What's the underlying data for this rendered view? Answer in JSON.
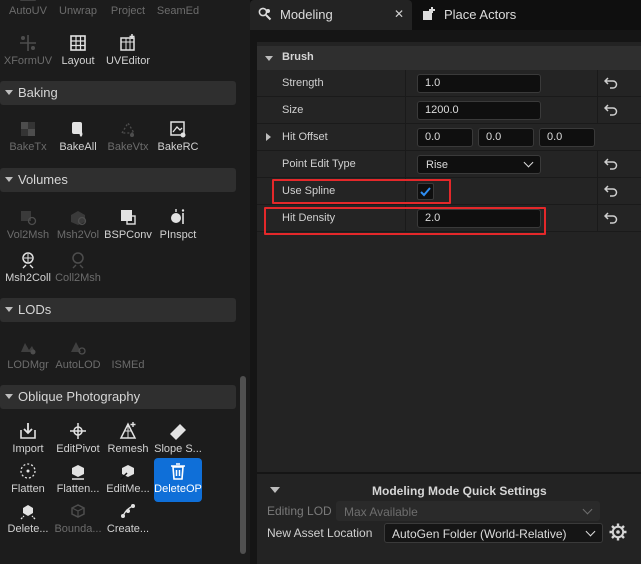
{
  "tool_panel": {
    "top_row": [
      {
        "label": "AutoUV",
        "icon": "auto-uv-icon",
        "enabled": false
      },
      {
        "label": "Unwrap",
        "icon": "unwrap-icon",
        "enabled": false
      },
      {
        "label": "Project",
        "icon": "project-icon",
        "enabled": false
      },
      {
        "label": "SeamEd",
        "icon": "seam-edit-icon",
        "enabled": false
      }
    ],
    "uv_row": [
      {
        "label": "XFormUV",
        "icon": "xform-uv-icon",
        "enabled": false
      },
      {
        "label": "Layout",
        "icon": "layout-icon",
        "enabled": true
      },
      {
        "label": "UVEditor",
        "icon": "uv-editor-icon",
        "enabled": true
      }
    ],
    "categories": {
      "baking": "Baking",
      "volumes": "Volumes",
      "lods": "LODs",
      "oblique": "Oblique Photography"
    },
    "baking": [
      {
        "label": "BakeTx",
        "icon": "bake-texture-icon",
        "enabled": false
      },
      {
        "label": "BakeAll",
        "icon": "bake-all-icon",
        "enabled": true
      },
      {
        "label": "BakeVtx",
        "icon": "bake-vertex-icon",
        "enabled": false
      },
      {
        "label": "BakeRC",
        "icon": "bake-rc-icon",
        "enabled": true
      }
    ],
    "volumes": [
      {
        "label": "Vol2Msh",
        "icon": "volume-to-mesh-icon",
        "enabled": false
      },
      {
        "label": "Msh2Vol",
        "icon": "mesh-to-volume-icon",
        "enabled": false
      },
      {
        "label": "BSPConv",
        "icon": "bsp-convert-icon",
        "enabled": true
      },
      {
        "label": "PInspct",
        "icon": "physics-inspect-icon",
        "enabled": true
      },
      {
        "label": "Msh2Coll",
        "icon": "mesh-to-collision-icon",
        "enabled": true
      },
      {
        "label": "Coll2Msh",
        "icon": "collision-to-mesh-icon",
        "enabled": false
      }
    ],
    "lods": [
      {
        "label": "LODMgr",
        "icon": "lod-manager-icon",
        "enabled": false
      },
      {
        "label": "AutoLOD",
        "icon": "auto-lod-icon",
        "enabled": false
      },
      {
        "label": "ISMEd",
        "icon": "",
        "enabled": false
      }
    ],
    "oblique": [
      {
        "label": "Import",
        "icon": "import-icon",
        "enabled": true
      },
      {
        "label": "EditPivot",
        "icon": "edit-pivot-icon",
        "enabled": true
      },
      {
        "label": "Remesh",
        "icon": "remesh-icon",
        "enabled": true
      },
      {
        "label": "Slope S...",
        "icon": "slope-icon",
        "enabled": true
      },
      {
        "label": "Flatten",
        "icon": "flatten-icon",
        "enabled": true
      },
      {
        "label": "Flatten...",
        "icon": "flatten-box-icon",
        "enabled": true
      },
      {
        "label": "EditMe...",
        "icon": "edit-mesh-icon",
        "enabled": true
      },
      {
        "label": "DeleteOP",
        "icon": "trash-icon",
        "enabled": true,
        "active": true
      },
      {
        "label": "Delete...",
        "icon": "delete-box-icon",
        "enabled": true
      },
      {
        "label": "Bounda...",
        "icon": "boundary-icon",
        "enabled": false
      },
      {
        "label": "Create...",
        "icon": "create-spline-icon",
        "enabled": true
      }
    ]
  },
  "tabs": [
    {
      "label": "Modeling",
      "icon": "modeling-mode-icon",
      "close": "✕",
      "active": true
    },
    {
      "label": "Place Actors",
      "icon": "place-actors-icon",
      "active": false
    }
  ],
  "details": {
    "section_title": "Brush",
    "properties": {
      "strength": {
        "label": "Strength",
        "value": "1.0"
      },
      "size": {
        "label": "Size",
        "value": "1200.0"
      },
      "hit_offset": {
        "label": "Hit Offset",
        "x": "0.0",
        "y": "0.0",
        "z": "0.0"
      },
      "point_edit_type": {
        "label": "Point Edit Type",
        "value": "Rise"
      },
      "use_spline": {
        "label": "Use Spline",
        "checked": true
      },
      "hit_density": {
        "label": "Hit Density",
        "value": "2.0"
      }
    },
    "highlight_color": "#e4282a",
    "accent_color": "#0f6fd8"
  },
  "quick_settings": {
    "title": "Modeling Mode Quick Settings",
    "editing_lod": {
      "label": "Editing LOD",
      "value": "Max Available",
      "enabled": false
    },
    "new_asset_location": {
      "label": "New Asset Location",
      "value": "AutoGen Folder (World-Relative)"
    }
  }
}
